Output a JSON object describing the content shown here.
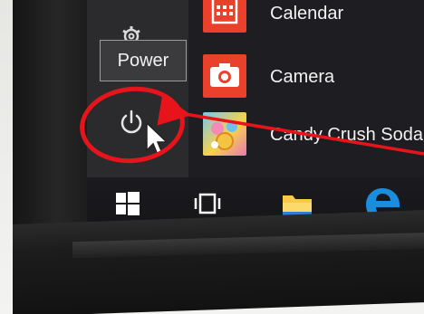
{
  "start_menu": {
    "apps": [
      {
        "label": "Calendar",
        "icon": "calendar-icon",
        "tile_color": "#e9412b"
      },
      {
        "label": "Camera",
        "icon": "camera-icon",
        "tile_color": "#e9412b"
      },
      {
        "label": "Candy Crush Soda",
        "icon": "candy-crush-icon",
        "tile_color": "#f0d24a"
      }
    ],
    "power_tooltip": "Power",
    "icons": [
      "settings-icon",
      "power-icon",
      "mouse-cursor-icon"
    ]
  },
  "taskbar": {
    "icons": [
      "windows-start-icon",
      "task-view-icon",
      "file-explorer-icon",
      "edge-icon"
    ]
  },
  "annotation": {
    "color": "#e8141c"
  }
}
